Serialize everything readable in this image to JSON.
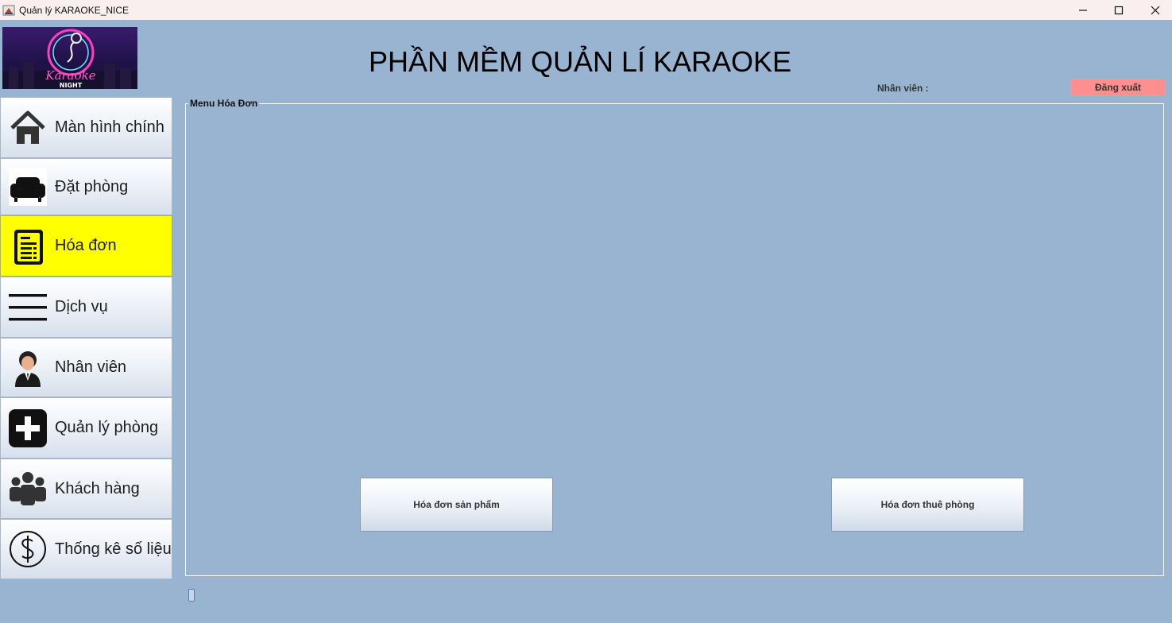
{
  "window": {
    "title": "Quản lý KARAOKE_NICE"
  },
  "header": {
    "logo_text": "Karaoke",
    "logo_subtext": "NIGHT",
    "app_title": "PHẦN MỀM QUẢN LÍ KARAOKE",
    "staff_label": "Nhân viên :",
    "logout_label": "Đăng xuất",
    "logout_color": "#ff8e8e"
  },
  "sidebar": {
    "active_color": "#ffff00",
    "items": [
      {
        "label": "Màn hình chính",
        "icon": "home-icon"
      },
      {
        "label": "Đặt phòng",
        "icon": "sofa-icon"
      },
      {
        "label": "Hóa đơn",
        "icon": "invoice-icon",
        "active": true
      },
      {
        "label": "Dịch vụ",
        "icon": "menu-lines-icon"
      },
      {
        "label": "Nhân viên",
        "icon": "employee-icon"
      },
      {
        "label": "Quản lý phòng",
        "icon": "plus-icon"
      },
      {
        "label": "Khách hàng",
        "icon": "customers-icon"
      },
      {
        "label": "Thống kê số liệu",
        "icon": "dollar-icon"
      }
    ]
  },
  "panel": {
    "legend": "Menu Hóa Đơn",
    "buttons": [
      {
        "label": "Hóa đơn sản phẩm"
      },
      {
        "label": "Hóa đơn thuê phòng"
      }
    ]
  }
}
